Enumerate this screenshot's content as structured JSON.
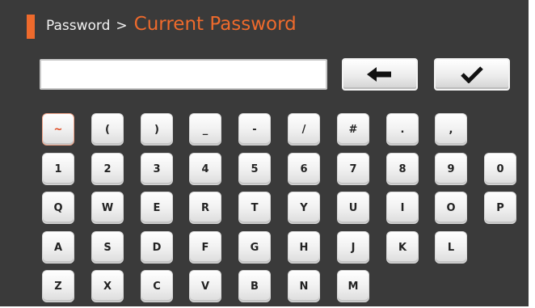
{
  "header": {
    "parent": "Password",
    "separator": ">",
    "current": "Current Password"
  },
  "password_input": {
    "value": ""
  },
  "actions": {
    "backspace_icon": "left-arrow-icon",
    "confirm_icon": "checkmark-icon"
  },
  "keyboard": {
    "rows": [
      [
        "~",
        "(",
        ")",
        "_",
        "-",
        "/",
        "#",
        ".",
        ","
      ],
      [
        "1",
        "2",
        "3",
        "4",
        "5",
        "6",
        "7",
        "8",
        "9",
        "0"
      ],
      [
        "Q",
        "W",
        "E",
        "R",
        "T",
        "Y",
        "U",
        "I",
        "O",
        "P"
      ],
      [
        "A",
        "S",
        "D",
        "F",
        "G",
        "H",
        "J",
        "K",
        "L"
      ],
      [
        "Z",
        "X",
        "C",
        "V",
        "B",
        "N",
        "M"
      ]
    ]
  },
  "colors": {
    "background": "#3a3a3a",
    "accent": "#ee6a2c",
    "key_face": "#f1f1f1"
  }
}
